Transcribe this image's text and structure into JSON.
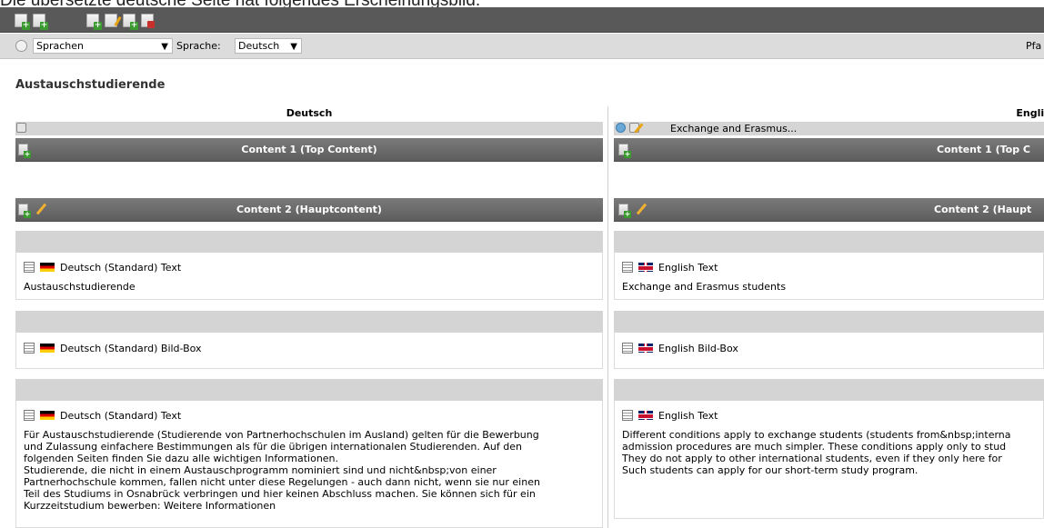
{
  "caption": "Die übersetzte deutsche Seite hat folgendes Erscheinungsbild:",
  "toolbar": {
    "icons": [
      "new-page-icon",
      "new-content-icon",
      "page-properties-icon",
      "edit-page-icon",
      "move-page-icon",
      "delete-page-icon"
    ]
  },
  "langbar": {
    "view_select": "Sprachen",
    "language_label": "Sprache:",
    "language_select": "Deutsch",
    "path_label": "Pfa"
  },
  "page_title": "Austauschstudierende",
  "columns": {
    "left": {
      "heading": "Deutsch",
      "sections": {
        "top": "Content 1 (Top Content)",
        "main": "Content 2 (Hauptcontent)"
      },
      "items": [
        {
          "header": "Deutsch (Standard) Text",
          "body": "Austauschstudierende"
        },
        {
          "header": "Deutsch (Standard) Bild-Box",
          "body": ""
        },
        {
          "header": "Deutsch (Standard) Text",
          "body": "Für Austauschstudierende (Studierende von Partnerhochschulen im Ausland) gelten für die Bewerbung\nund Zulassung einfachere Bestimmungen als für die übrigen internationalen Studierenden. Auf den\nfolgenden Seiten finden Sie dazu alle wichtigen Informationen.\nStudierende, die nicht in einem Austauschprogramm nominiert sind und nicht&nbsp;von einer\nPartnerhochschule kommen, fallen nicht unter diese Regelungen - auch dann nicht, wenn sie nur einen\nTeil des Studiums in Osnabrück verbringen und hier keinen Abschluss machen. Sie können sich für ein\nKurzzeitstudium bewerben: Weitere Informationen"
        }
      ]
    },
    "right": {
      "heading": "English",
      "page_title": "Exchange and Erasmus...",
      "sections": {
        "top": "Content 1 (Top C",
        "main": "Content 2 (Haupt"
      },
      "items": [
        {
          "header": "English Text",
          "body": "Exchange and Erasmus students"
        },
        {
          "header": "English Bild-Box",
          "body": ""
        },
        {
          "header": "English Text",
          "body": "Different conditions apply to exchange students (students from&nbsp;interna\nadmission procedures are much simpler. These conditions apply only to stud\nThey do not apply to other international students, even if they only here for\nSuch students can apply for our short-term study program."
        }
      ]
    }
  }
}
